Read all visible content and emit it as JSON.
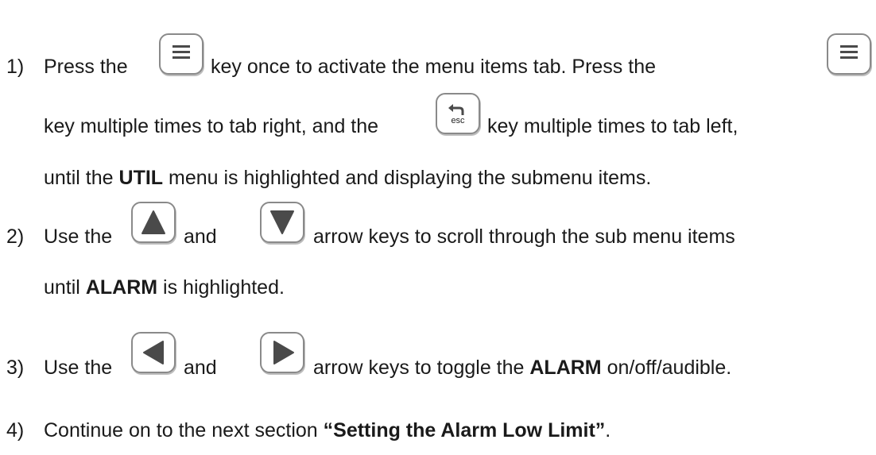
{
  "steps": [
    {
      "number": "1)",
      "l1a": "Press the",
      "l1b": "key once to activate the menu items tab.  Press the",
      "l2a": "key multiple times to tab right, and the",
      "l2b": "key multiple times to tab left,",
      "l3a": "until the",
      "l3bold": "UTIL",
      "l3b": "menu is highlighted and displaying the submenu items."
    },
    {
      "number": "2)",
      "l1a": "Use the",
      "l1mid": "and",
      "l1b": "arrow keys to scroll through the sub menu items",
      "l2a": "until",
      "l2bold": "ALARM",
      "l2b": "is highlighted."
    },
    {
      "number": "3)",
      "l1a": "Use the",
      "l1mid": "and",
      "l1b": "arrow keys to toggle the",
      "l1bold": "ALARM",
      "l1c": "on/off/audible."
    },
    {
      "number": "4)",
      "l1a": "Continue on to the next section",
      "l1bold": "“Setting the Alarm Low Limit”",
      "l1c": "."
    }
  ],
  "keys": {
    "menu_icon": "menu-icon",
    "esc_icon": "back-arrow-icon",
    "esc_label": "esc",
    "up_icon": "up-triangle-icon",
    "down_icon": "down-triangle-icon",
    "left_icon": "left-triangle-icon",
    "right_icon": "right-triangle-icon",
    "key_border_color": "#8a8a8a",
    "icon_color": "#4a4a4a"
  }
}
